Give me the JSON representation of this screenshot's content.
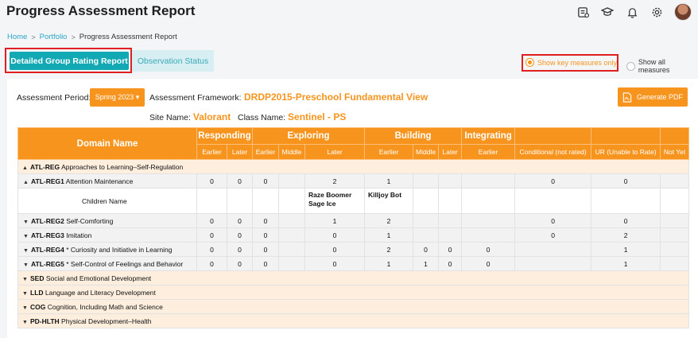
{
  "header": {
    "title": "Progress Assessment Report"
  },
  "breadcrumb": {
    "home": "Home",
    "portfolio": "Portfolio",
    "current": "Progress Assessment Report",
    "sep": ">"
  },
  "tabs": {
    "active": "Detailed Group Rating Report",
    "inactive": "Observation Status"
  },
  "radios": {
    "key": "Show key measures only",
    "all": "Show all measures"
  },
  "filters": {
    "period_label": "Assessment Period:",
    "period_value": "Spring 2023 ▾",
    "framework_label": "Assessment Framework:",
    "framework_value": "DRDP2015-Preschool Fundamental View",
    "site_label": "Site Name:",
    "site_value": "Valorant",
    "class_label": "Class Name:",
    "class_value": "Sentinel - PS",
    "pdf_label": "Generate PDF"
  },
  "table": {
    "domain_header": "Domain Name",
    "groups": [
      "Responding",
      "Exploring",
      "Building",
      "Integrating"
    ],
    "subheaders": [
      "Earlier",
      "Later",
      "Earlier",
      "Middle",
      "Later",
      "Earlier",
      "Middle",
      "Later",
      "Earlier",
      "Conditional (not rated)",
      "UR (Unable to Rate)",
      "Not Yet"
    ],
    "domains": [
      {
        "code": "ATL-REG",
        "name": "Approaches to Learning–Self-Regulation"
      },
      {
        "code": "SED",
        "name": "Social and Emotional Development"
      },
      {
        "code": "LLD",
        "name": "Language and Literacy Development"
      },
      {
        "code": "COG",
        "name": "Cognition, Including Math and Science"
      },
      {
        "code": "PD-HLTH",
        "name": "Physical Development–Health"
      }
    ],
    "measures": [
      {
        "code": "ATL-REG1",
        "name": "Attention Maintenance",
        "vals": [
          "0",
          "0",
          "0",
          "",
          "2",
          "1",
          "",
          "",
          "",
          "0",
          "0",
          ""
        ]
      },
      {
        "code": "ATL-REG2",
        "name": "Self-Comforting",
        "vals": [
          "0",
          "0",
          "0",
          "",
          "1",
          "2",
          "",
          "",
          "",
          "0",
          "0",
          ""
        ]
      },
      {
        "code": "ATL-REG3",
        "name": "Imitation",
        "vals": [
          "0",
          "0",
          "0",
          "",
          "0",
          "1",
          "",
          "",
          "",
          "0",
          "2",
          ""
        ]
      },
      {
        "code": "ATL-REG4",
        "name": "* Curiosity and Initiative in Learning",
        "vals": [
          "0",
          "0",
          "0",
          "",
          "0",
          "2",
          "0",
          "0",
          "0",
          "",
          "1",
          ""
        ]
      },
      {
        "code": "ATL-REG5",
        "name": "* Self-Control of Feelings and Behavior",
        "vals": [
          "0",
          "0",
          "0",
          "",
          "0",
          "1",
          "1",
          "0",
          "0",
          "",
          "1",
          ""
        ]
      }
    ],
    "children": {
      "label": "Children Name",
      "later_col": "Raze Boomer\nSage Ice",
      "building_earlier": "Killjoy Bot"
    }
  }
}
